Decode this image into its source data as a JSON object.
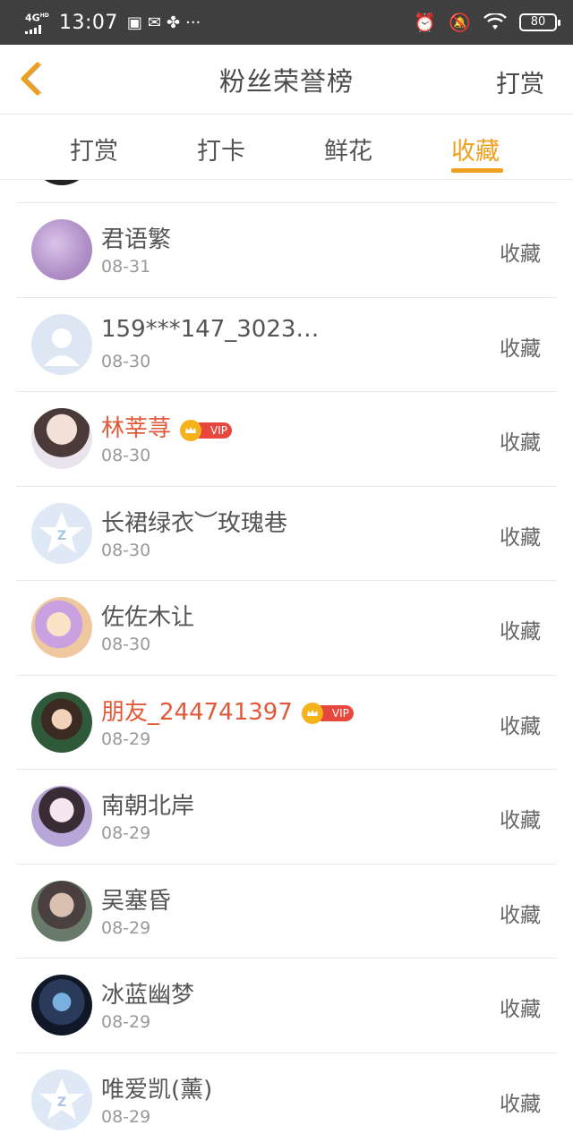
{
  "status_bar": {
    "network": "4G",
    "network_sup": "HD",
    "time": "13:07",
    "battery": "80"
  },
  "nav": {
    "title": "粉丝荣誉榜",
    "action": "打赏"
  },
  "tabs": [
    {
      "label": "打赏",
      "active": false
    },
    {
      "label": "打卡",
      "active": false
    },
    {
      "label": "鲜花",
      "active": false
    },
    {
      "label": "收藏",
      "active": true
    }
  ],
  "colors": {
    "accent": "#f0a020",
    "vip_name": "#e05a3a",
    "vip_tag": "#e8473e"
  },
  "vip_label": "VIP",
  "fans": [
    {
      "name": "君语繁",
      "date": "08-31",
      "action": "收藏",
      "vip": false,
      "avatar": "photo-purple"
    },
    {
      "name": "159***147_3023…",
      "date": "08-30",
      "action": "收藏",
      "vip": false,
      "avatar": "default-user"
    },
    {
      "name": "林莘荨",
      "date": "08-30",
      "action": "收藏",
      "vip": true,
      "avatar": "photo-girl"
    },
    {
      "name": "长裙绿衣︶玫瑰巷",
      "date": "08-30",
      "action": "收藏",
      "vip": false,
      "avatar": "default-star"
    },
    {
      "name": "佐佐木让",
      "date": "08-30",
      "action": "收藏",
      "vip": false,
      "avatar": "photo-anime"
    },
    {
      "name": "朋友_244741397",
      "date": "08-29",
      "action": "收藏",
      "vip": true,
      "avatar": "photo-cartoon"
    },
    {
      "name": "南朝北岸",
      "date": "08-29",
      "action": "收藏",
      "vip": false,
      "avatar": "photo-woman"
    },
    {
      "name": "吴塞昏",
      "date": "08-29",
      "action": "收藏",
      "vip": false,
      "avatar": "photo-man"
    },
    {
      "name": "冰蓝幽梦",
      "date": "08-29",
      "action": "收藏",
      "vip": false,
      "avatar": "photo-dark"
    },
    {
      "name": "唯爱凯(薰)",
      "date": "08-29",
      "action": "收藏",
      "vip": false,
      "avatar": "default-star"
    }
  ]
}
